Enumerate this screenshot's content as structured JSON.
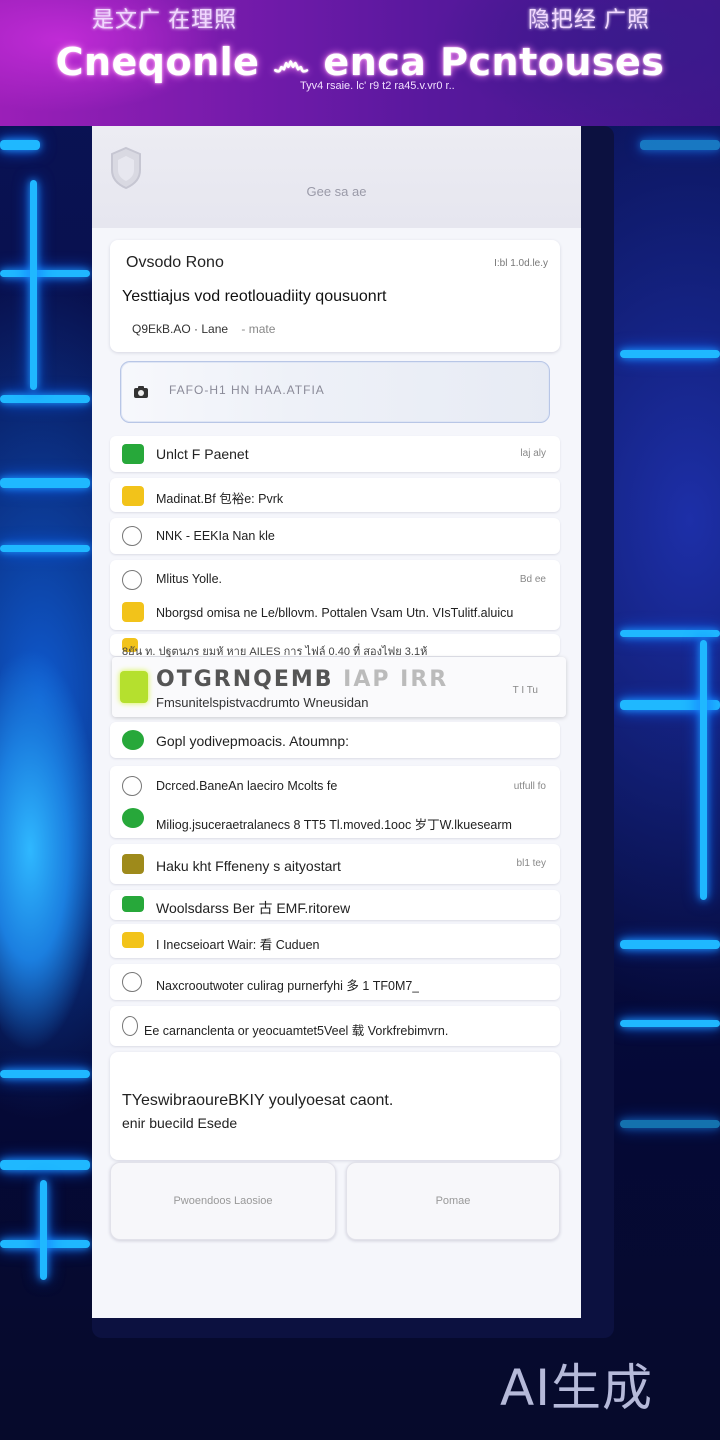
{
  "banner": {
    "top_left": "是文广 在理照",
    "top_right": "隐把经 广照",
    "title": "Cneqonle ෴ enca Pcntouses",
    "subtitle": "Tyv4 rsaie. lc' r9 t2 ra45.v.vr0 r.."
  },
  "panel": {
    "title": "Gee sa ae"
  },
  "hero": {
    "name": "Ovsodo Rono",
    "date": "I:bl 1.0d.le.y",
    "description": "Yesttiajus vod reotlouadiity qousuonrt",
    "meta_primary": "Q9EkB.AO",
    "meta_secondary": "· Lane",
    "meta_tertiary": "- mate"
  },
  "search": {
    "placeholder": "FAFO-H1 HN HAA.ATFIA"
  },
  "rows": [
    {
      "icon": "green-square-icon",
      "label": "Unlct F Paenet",
      "badge": "laj aly"
    },
    {
      "icon": "yellow-lock-icon",
      "label": "Madinat.Bf 包裕e: Pvrk",
      "badge": ""
    },
    {
      "icon": "headset-icon",
      "label": "NNK - EEKIa Nan kle",
      "badge": ""
    },
    {
      "icon": "clock-icon",
      "label": "Mlitus Yolle.",
      "badge": "Bd ee"
    },
    {
      "icon": "yellow-lock-icon",
      "label": "Nborgsd omisa ne Le/bllovm. Pottalen Vsam Utn. VIsTulitf.aluicu",
      "badge": ""
    },
    {
      "icon": "green-lock-icon",
      "label": "Gopl yodivepmoacis. Atoumnp:",
      "badge": ""
    },
    {
      "icon": "refresh-icon",
      "label": "Dcrced.BaneAn laeciro Mcolts fe",
      "badge": "utfull fo"
    },
    {
      "icon": "green-lock-icon",
      "label": "Miliog.jsuceraetralanecs 8 TT5 Tl.moved.1ooc 岁丁W.lkuesearm",
      "badge": ""
    },
    {
      "icon": "olive-b-icon",
      "label": "Haku kht Fffeneny s aityostart",
      "badge": "bl1 tey"
    },
    {
      "icon": "green-lock-icon",
      "label": "Woolsdarss Ber 古 EMF.ritorew",
      "badge": ""
    },
    {
      "icon": "yellow-lock-icon",
      "label": "I Inecseioart Wair: 看 Cuduen",
      "badge": ""
    },
    {
      "icon": "clock-icon",
      "label": "Naxcrooutwoter culirag purnerfyhi 多 1 TF0M7_",
      "badge": ""
    },
    {
      "icon": "refresh-icon",
      "label": "Ee carnanclenta or yeocuamtet5Veel 载 Vorkfrebimvrn.",
      "badge": ""
    }
  ],
  "overlay": {
    "strip": "8ยัน ท. ปฐตนภร ยมหั หาย AILES การ ไฟล์ 0.40 ที่ สองไฟย 3.1ห้",
    "title_bold": "OTGRNQEMB",
    "title_fade": " IAP IRR",
    "subtitle": "Fmsunitelspistvacdrumto Wneusidan",
    "badge": "T I Tu"
  },
  "message": {
    "line1": "TYeswibraoureBKIY youlyoesat caont.",
    "line2": "enir buecild Esede"
  },
  "buttons": {
    "left": "Pwoendoos Laosioe",
    "right": "Pomae"
  },
  "watermark": "AI生成"
}
